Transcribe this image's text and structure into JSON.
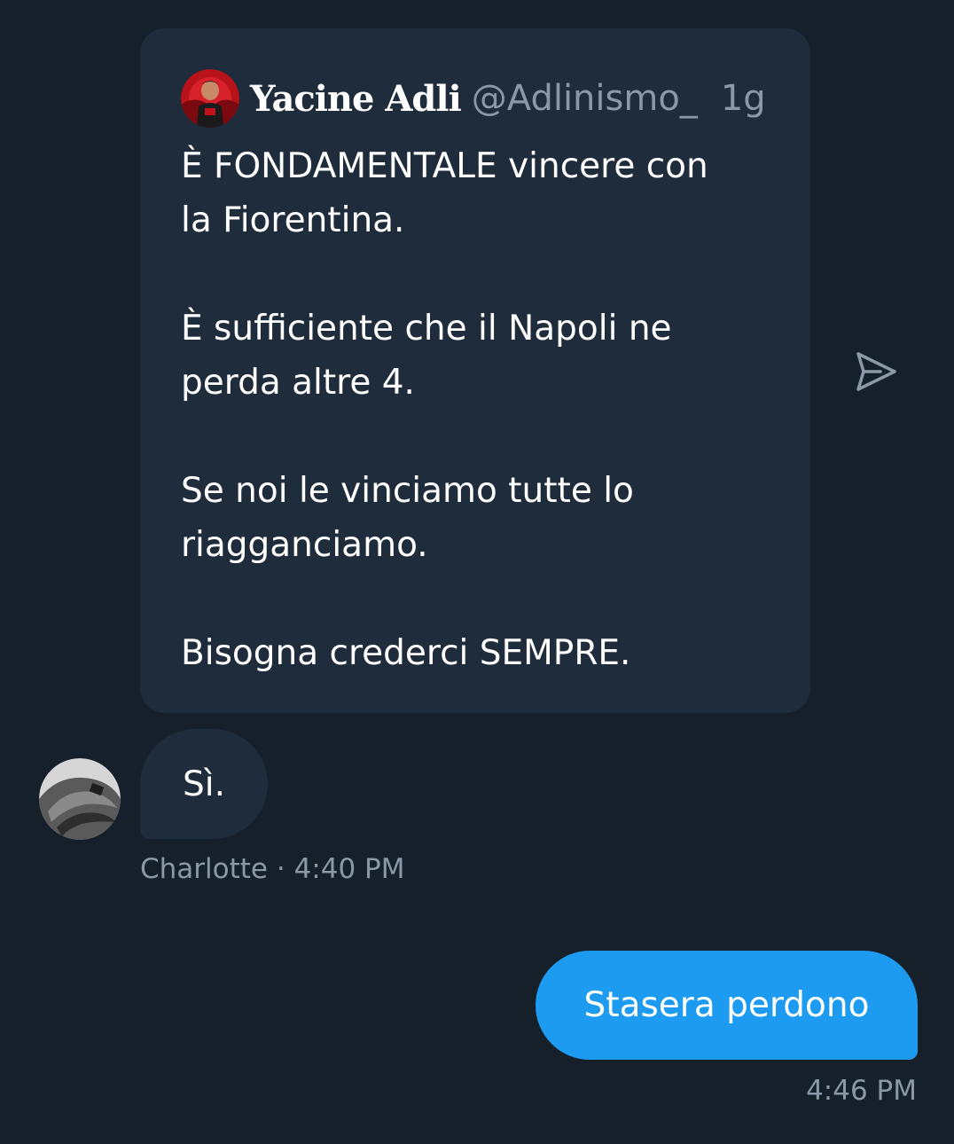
{
  "quoted_tweet": {
    "author_name": "Yacine Adli",
    "author_handle": "@Adlinismo_",
    "age": "1g",
    "text": "È FONDAMENTALE vincere con\nla Fiorentina.\n\nÈ sufficiente che il Napoli ne\nperda altre 4.\n\nSe noi le vinciamo tutte lo\nriagganciamo.\n\nBisogna crederci SEMPRE.",
    "avatar_icon": "profile-photo-red",
    "share_icon": "send-arrow-icon"
  },
  "incoming_message": {
    "text": "Sì.",
    "sender": "Charlotte",
    "separator": "·",
    "time": "4:40 PM",
    "avatar_icon": "profile-photo-grayscale"
  },
  "outgoing_message": {
    "text": "Stasera perdono",
    "time": "4:46 PM"
  },
  "colors": {
    "background": "#15202b",
    "bubble_incoming": "#1e2c3c",
    "bubble_outgoing": "#1d9bf0",
    "text_primary": "#ffffff",
    "text_secondary": "#8b98a5"
  }
}
